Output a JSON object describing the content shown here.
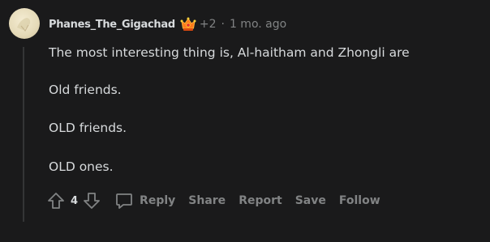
{
  "comment": {
    "avatar_icon": "user-avatar",
    "username": "Phanes_The_Gigachad",
    "flair_icon": "crown-award-icon",
    "award_count": "+2",
    "separator": "·",
    "timestamp": "1 mo. ago",
    "body": [
      "The most interesting thing is, Al-haitham and Zhongli are",
      "Old friends.",
      "OLD friends.",
      "OLD ones."
    ]
  },
  "actions": {
    "upvote_icon": "upvote-arrow-icon",
    "score": "4",
    "downvote_icon": "downvote-arrow-icon",
    "reply_icon": "speech-bubble-icon",
    "reply": "Reply",
    "share": "Share",
    "report": "Report",
    "save": "Save",
    "follow": "Follow"
  },
  "colors": {
    "background": "#1a1a1b",
    "text": "#d7dadc",
    "muted": "#818384",
    "thread_line": "#343536",
    "award_orange": "#ff6a00"
  }
}
